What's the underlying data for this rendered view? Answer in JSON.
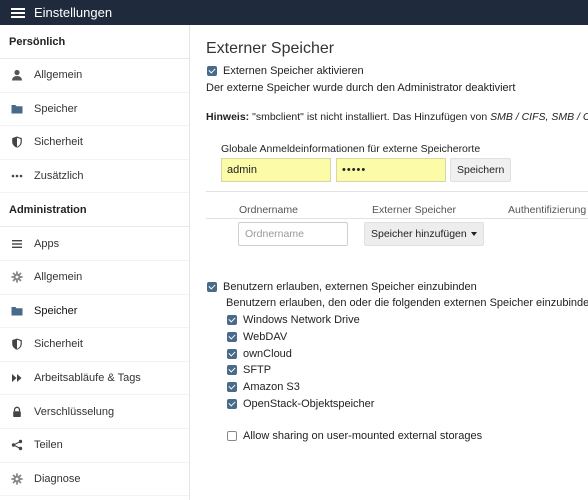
{
  "header": {
    "title": "Einstellungen"
  },
  "sidebar": {
    "personal_title": "Persönlich",
    "personal": [
      {
        "label": "Allgemein",
        "icon": "user-icon"
      },
      {
        "label": "Speicher",
        "icon": "folder-icon"
      },
      {
        "label": "Sicherheit",
        "icon": "shield-icon"
      },
      {
        "label": "Zusätzlich",
        "icon": "more-icon"
      }
    ],
    "admin_title": "Administration",
    "admin": [
      {
        "label": "Apps",
        "icon": "list-icon"
      },
      {
        "label": "Allgemein",
        "icon": "gear-icon"
      },
      {
        "label": "Speicher",
        "icon": "folder-icon",
        "active": true
      },
      {
        "label": "Sicherheit",
        "icon": "shield-icon"
      },
      {
        "label": "Arbeitsabläufe & Tags",
        "icon": "fast-forward-icon"
      },
      {
        "label": "Verschlüsselung",
        "icon": "lock-icon"
      },
      {
        "label": "Teilen",
        "icon": "share-icon"
      },
      {
        "label": "Diagnose",
        "icon": "gear-icon"
      }
    ]
  },
  "main": {
    "title": "Externer Speicher",
    "enable_label": "Externen Speicher aktivieren",
    "disabled_note": "Der externe Speicher wurde durch den Administrator deaktiviert",
    "hint_bold": "Hinweis:",
    "hint_text": " \"smbclient\" ist nicht installiert. Das Hinzufügen von ",
    "hint_italic": "SMB / CIFS, SMB / CIFS",
    "creds_label": "Globale Anmeldeinformationen für externe Speicherorte",
    "username_value": "admin",
    "password_value": "•••••",
    "save_label": "Speichern",
    "table": {
      "headers": [
        "Ordnername",
        "Externer Speicher",
        "Authentifizierung"
      ],
      "folder_placeholder": "Ordnername",
      "add_storage_label": "Speicher hinzufügen"
    },
    "allow_users_label": "Benutzern erlauben, externen Speicher einzubinden",
    "allow_users_sub": "Benutzern erlauben, den oder die folgenden externen Speicher einzubinden:",
    "backends": [
      "Windows Network Drive",
      "WebDAV",
      "ownCloud",
      "SFTP",
      "Amazon S3",
      "OpenStack-Objektspeicher"
    ],
    "sharing_label": "Allow sharing on user-mounted external storages"
  }
}
